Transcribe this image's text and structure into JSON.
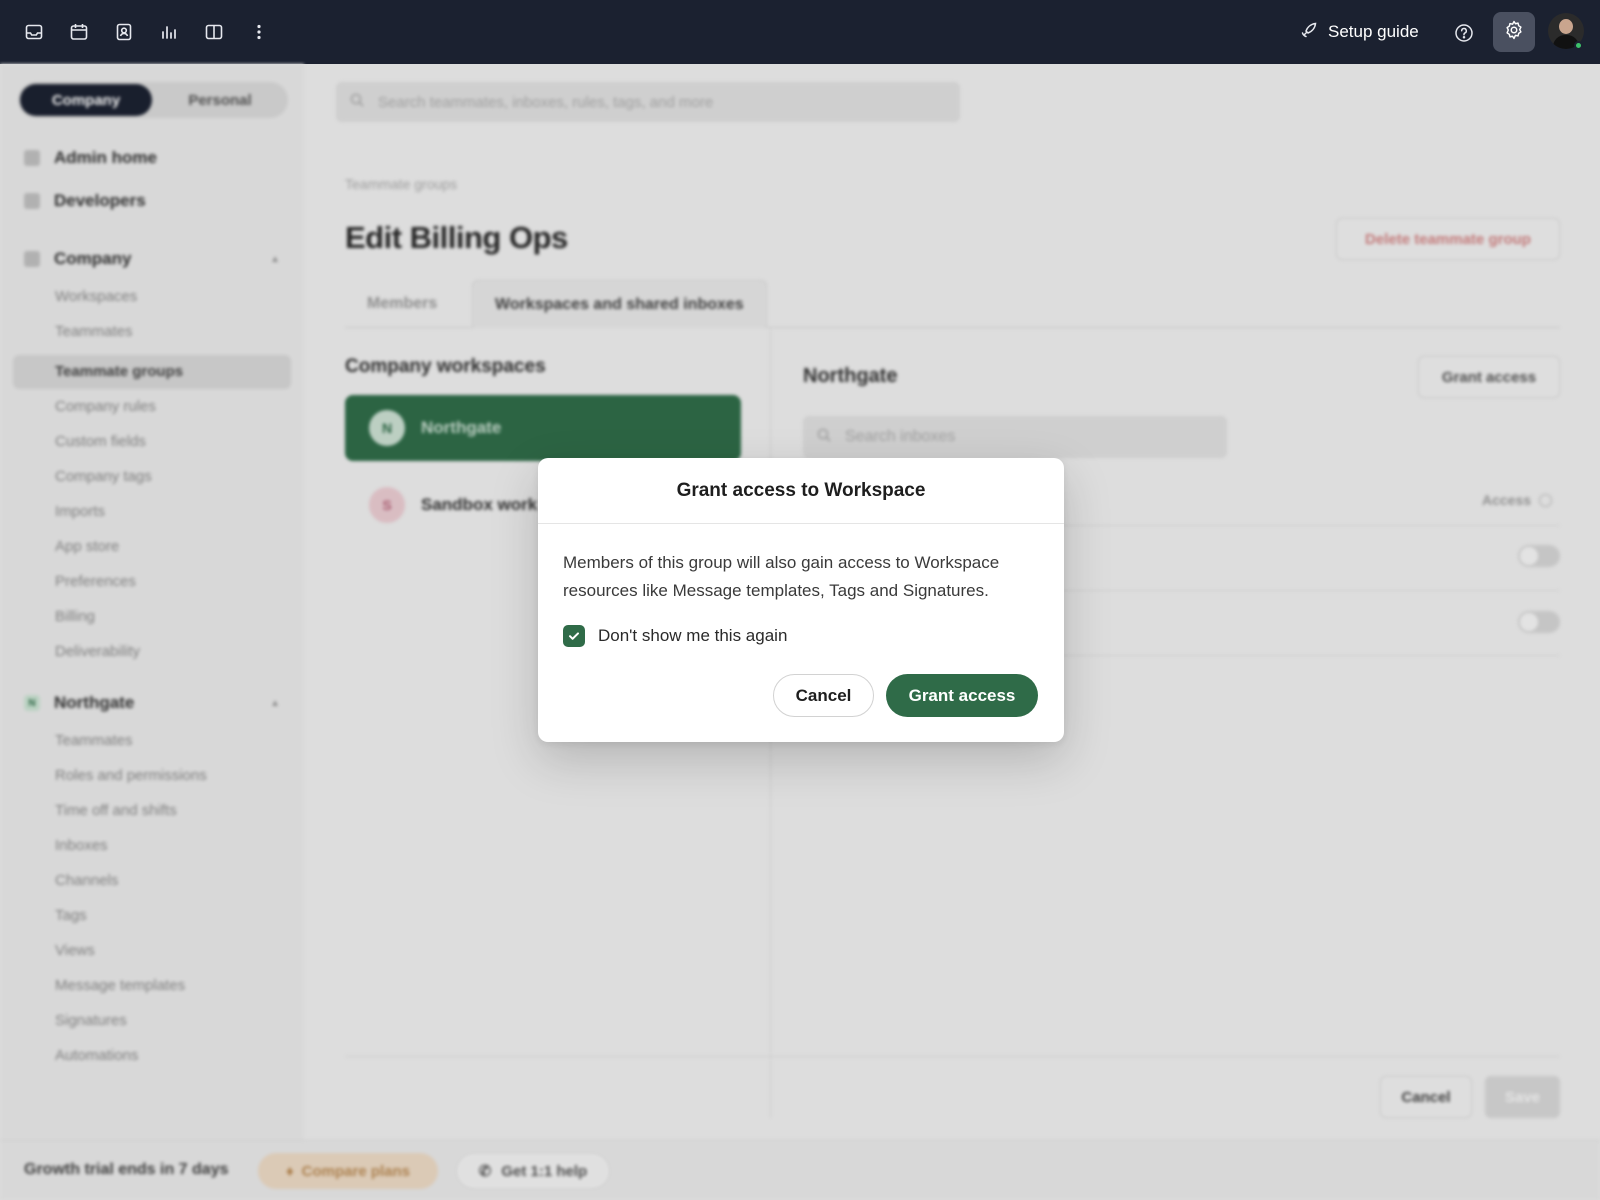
{
  "topbar": {
    "icons": [
      "inbox-icon",
      "calendar-icon",
      "contacts-icon",
      "analytics-icon",
      "panel-icon",
      "more-icon"
    ],
    "setup_guide_label": "Setup guide",
    "help_icon": "help-icon",
    "settings_icon": "gear-icon"
  },
  "sidebar": {
    "segment": {
      "company": "Company",
      "personal": "Personal"
    },
    "top_items": [
      {
        "label": "Admin home",
        "icon": "home-icon"
      },
      {
        "label": "Developers",
        "icon": "code-icon"
      }
    ],
    "company_section": {
      "label": "Company",
      "items": [
        "Workspaces",
        "Teammates",
        "Teammate groups",
        "Company rules",
        "Custom fields",
        "Company tags",
        "Imports",
        "App store",
        "Preferences",
        "Billing",
        "Deliverability"
      ],
      "active": "Teammate groups"
    },
    "workspace_section": {
      "badge": "N",
      "label": "Northgate",
      "items": [
        "Teammates",
        "Roles and permissions",
        "Time off and shifts",
        "Inboxes",
        "Channels",
        "Tags",
        "Views",
        "Message templates",
        "Signatures",
        "Automations"
      ]
    }
  },
  "bottombar": {
    "trial_text": "Growth trial ends in 7 days",
    "compare_label": "Compare plans",
    "help_label": "Get 1:1 help"
  },
  "main": {
    "search_placeholder": "Search teammates, inboxes, rules, tags, and more",
    "breadcrumb": "Teammate groups",
    "title": "Edit Billing Ops",
    "delete_label": "Delete teammate group",
    "tabs": [
      {
        "label": "Members",
        "active": false
      },
      {
        "label": "Workspaces and shared inboxes",
        "active": true
      }
    ],
    "company_workspaces_title": "Company workspaces",
    "workspaces": [
      {
        "initial": "N",
        "name": "Northgate",
        "active": true,
        "color": "#2f6b48"
      },
      {
        "initial": "S",
        "name": "Sandbox work",
        "active": false,
        "color": "#e7c9cf"
      }
    ],
    "right_title": "Northgate",
    "grant_access_label": "Grant access",
    "search_inboxes_placeholder": "Search inboxes",
    "access_header": "Access",
    "cancel_label": "Cancel",
    "save_label": "Save"
  },
  "modal": {
    "title": "Grant access to Workspace",
    "body": "Members of this group will also gain access to Workspace resources like Message templates, Tags and Signatures.",
    "checkbox_label": "Don't show me this again",
    "checkbox_checked": true,
    "cancel_label": "Cancel",
    "confirm_label": "Grant access"
  },
  "colors": {
    "topbar_bg": "#1b2130",
    "accent_green": "#2f6b48",
    "danger_text": "#d08282"
  }
}
